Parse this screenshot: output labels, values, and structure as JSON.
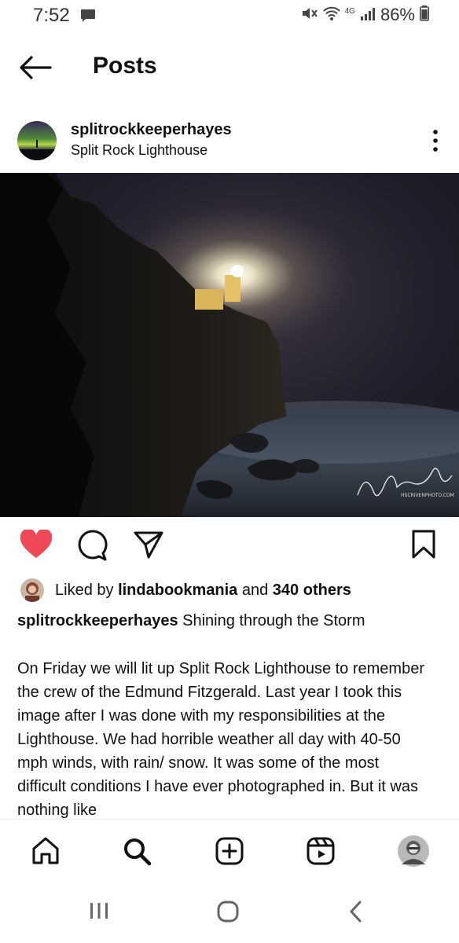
{
  "status_bar": {
    "time": "7:52",
    "network": "4G",
    "battery": "86%",
    "icons": [
      "message-icon",
      "mute-icon",
      "wifi-icon",
      "signal-icon",
      "battery-icon"
    ]
  },
  "header": {
    "title": "Posts",
    "back_icon": "back-arrow-icon"
  },
  "post": {
    "username": "splitrockkeeperhayes",
    "location": "Split Rock Lighthouse",
    "more_icon": "more-vertical-icon",
    "image_signature": "HSCRIVENPHOTO.COM",
    "liked_by_prefix": "Liked by ",
    "liked_by_user": "lindabookmania",
    "liked_by_middle": " and ",
    "liked_by_count": "340 others",
    "caption_user": "splitrockkeeperhayes",
    "caption_text": " Shining through the Storm",
    "body": "On Friday we will lit up Split Rock Lighthouse to remember the crew of the Edmund Fitzgerald. Last year I took this image after I was done with my responsibilities at the Lighthouse. We had horrible weather all day with 40-50 mph winds, with rain/ snow. It was some of the most difficult conditions I have ever photographed in.  But it was nothing like"
  },
  "actions": {
    "like_icon": "heart-filled-icon",
    "comment_icon": "comment-icon",
    "share_icon": "send-icon",
    "save_icon": "bookmark-icon",
    "like_color": "#ED4956"
  },
  "bottom_nav": {
    "items": [
      "home-icon",
      "search-icon",
      "create-icon",
      "reels-icon",
      "profile-avatar"
    ]
  },
  "system_nav": {
    "items": [
      "recents-icon",
      "home-circle-icon",
      "back-chevron-icon"
    ]
  }
}
